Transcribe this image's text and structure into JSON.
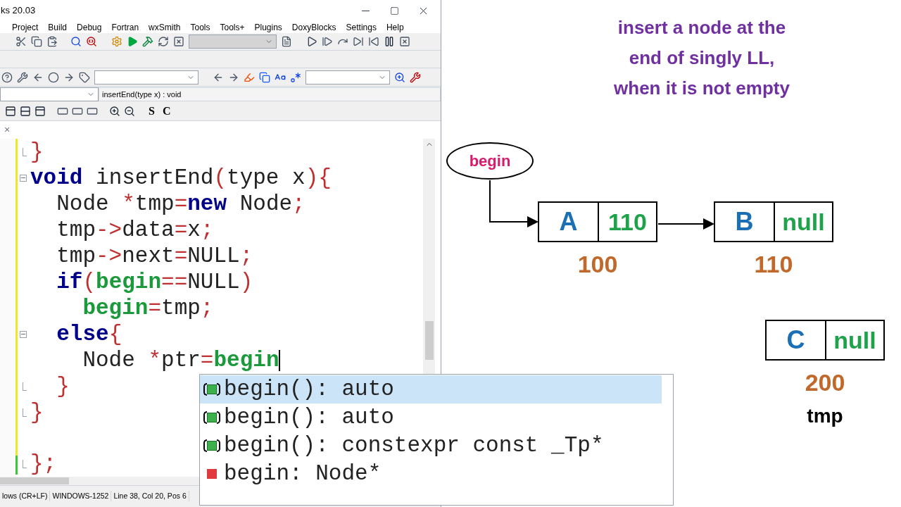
{
  "window": {
    "title": "ks 20.03"
  },
  "menu": [
    "Project",
    "Build",
    "Debug",
    "Fortran",
    "wxSmith",
    "Tools",
    "Tools+",
    "Plugins",
    "DoxyBlocks",
    "Settings",
    "Help"
  ],
  "build_target": {
    "disabled": true
  },
  "scope_field": {
    "value": "insertEnd(type x) : void"
  },
  "format_buttons": [
    "S",
    "C"
  ],
  "tab": {
    "close": "×"
  },
  "editor": {
    "lines": [
      {
        "kind": "fold_end",
        "cursor": false,
        "tokens": [
          {
            "t": "}",
            "kind": "punct"
          }
        ]
      },
      {
        "kind": "fold_start",
        "cursor": false,
        "tokens": [
          {
            "t": "void",
            "kind": "keyword"
          },
          {
            "t": " insertEnd",
            "kind": "plain"
          },
          {
            "t": "(",
            "kind": "punct"
          },
          {
            "t": "type x",
            "kind": "plain"
          },
          {
            "t": ")",
            "kind": "punct"
          },
          {
            "t": "{",
            "kind": "punct"
          }
        ]
      },
      {
        "kind": "code",
        "cursor": false,
        "tokens": [
          {
            "t": "  Node ",
            "kind": "plain"
          },
          {
            "t": "*",
            "kind": "punct"
          },
          {
            "t": "tmp",
            "kind": "plain"
          },
          {
            "t": "=",
            "kind": "punct"
          },
          {
            "t": "new",
            "kind": "keyword"
          },
          {
            "t": " Node",
            "kind": "plain"
          },
          {
            "t": ";",
            "kind": "punct"
          }
        ]
      },
      {
        "kind": "code",
        "cursor": false,
        "tokens": [
          {
            "t": "  tmp",
            "kind": "plain"
          },
          {
            "t": "->",
            "kind": "punct"
          },
          {
            "t": "data",
            "kind": "plain"
          },
          {
            "t": "=",
            "kind": "punct"
          },
          {
            "t": "x",
            "kind": "plain"
          },
          {
            "t": ";",
            "kind": "punct"
          }
        ]
      },
      {
        "kind": "code",
        "cursor": false,
        "tokens": [
          {
            "t": "  tmp",
            "kind": "plain"
          },
          {
            "t": "->",
            "kind": "punct"
          },
          {
            "t": "next",
            "kind": "plain"
          },
          {
            "t": "=",
            "kind": "punct"
          },
          {
            "t": "NULL",
            "kind": "plain"
          },
          {
            "t": ";",
            "kind": "punct"
          }
        ]
      },
      {
        "kind": "code",
        "cursor": false,
        "tokens": [
          {
            "t": "  if",
            "kind": "keyword"
          },
          {
            "t": "(",
            "kind": "punct"
          },
          {
            "t": "begin",
            "kind": "global"
          },
          {
            "t": "==",
            "kind": "punct"
          },
          {
            "t": "NULL",
            "kind": "plain"
          },
          {
            "t": ")",
            "kind": "punct"
          }
        ]
      },
      {
        "kind": "code",
        "cursor": false,
        "tokens": [
          {
            "t": "    begin",
            "kind": "global"
          },
          {
            "t": "=",
            "kind": "punct"
          },
          {
            "t": "tmp",
            "kind": "plain"
          },
          {
            "t": ";",
            "kind": "punct"
          }
        ]
      },
      {
        "kind": "fold_start",
        "cursor": false,
        "tokens": [
          {
            "t": "  else",
            "kind": "keyword"
          },
          {
            "t": "{",
            "kind": "punct"
          }
        ]
      },
      {
        "kind": "code",
        "cursor": true,
        "tokens": [
          {
            "t": "    Node ",
            "kind": "plain"
          },
          {
            "t": "*",
            "kind": "punct"
          },
          {
            "t": "ptr",
            "kind": "plain"
          },
          {
            "t": "=",
            "kind": "punct"
          },
          {
            "t": "begin",
            "kind": "global"
          }
        ]
      },
      {
        "kind": "fold_end",
        "cursor": false,
        "tokens": [
          {
            "t": "  }",
            "kind": "punct"
          }
        ]
      },
      {
        "kind": "fold_end",
        "cursor": false,
        "tokens": [
          {
            "t": "}",
            "kind": "punct"
          }
        ]
      },
      {
        "kind": "code",
        "cursor": false
      },
      {
        "kind": "fold_end",
        "cursor": false,
        "tokens": [
          {
            "t": "}",
            "kind": "punct"
          },
          {
            "t": ";",
            "kind": "punct"
          }
        ]
      }
    ]
  },
  "completion": [
    {
      "kind": "method",
      "text": "begin(): auto",
      "selected": true
    },
    {
      "kind": "method",
      "text": "begin(): auto",
      "selected": false
    },
    {
      "kind": "method",
      "text": "begin(): constexpr const _Tp*",
      "selected": false
    },
    {
      "kind": "variable",
      "text": "begin: Node*",
      "selected": false
    }
  ],
  "status_bar": [
    "lows (CR+LF)",
    "WINDOWS-1252",
    "Line 38, Col 20, Pos 6"
  ],
  "board": {
    "heading": "insert a node at the\nend of singly LL,\nwhen it is not empty",
    "pointer": "begin",
    "list": [
      {
        "data": "A",
        "next": "110",
        "address": "100"
      },
      {
        "data": "B",
        "next": "null",
        "address": "110"
      }
    ],
    "new_node": {
      "data": "C",
      "next": "null",
      "address": "200",
      "label": "tmp"
    }
  }
}
